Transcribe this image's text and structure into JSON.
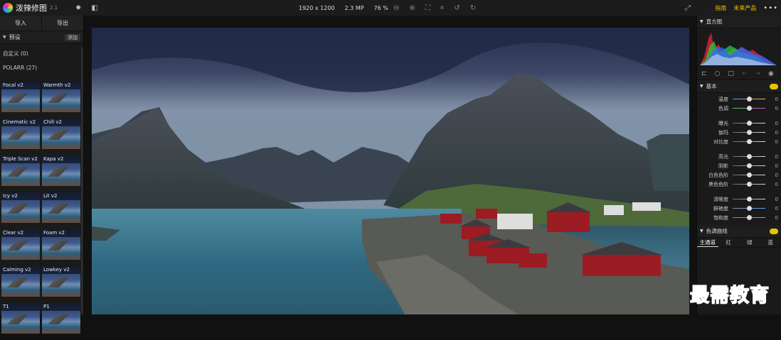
{
  "app": {
    "title": "泼辣修图",
    "version": "2.1"
  },
  "stats": {
    "resolution": "1920 x 1200",
    "megapixels": "2.3 MP",
    "zoom": "76 %"
  },
  "links": {
    "guide": "指南",
    "future": "未来产品"
  },
  "left": {
    "import": "导入",
    "export": "导出",
    "presets_label": "预设",
    "add_label": "添加",
    "custom_group": "自定义 (0)",
    "polarr_group": "POLARR (27)",
    "presets": [
      "Focal v2",
      "Warmth v2",
      "Cinematic v2",
      "Chill v2",
      "Triple Scan v2",
      "Kapa v2",
      "Icy v2",
      "Lit v2",
      "Clear v2",
      "Foam v2",
      "Calming v2",
      "Lowkey v2",
      "T1",
      "P1"
    ]
  },
  "right": {
    "histogram_label": "直方图",
    "basic_label": "基本",
    "sliders": [
      {
        "label": "温度",
        "value": "0",
        "colors": [
          "#4aa3ff",
          "#ffb340"
        ]
      },
      {
        "label": "色调",
        "value": "0",
        "colors": [
          "#3ccb5a",
          "#d34cd6"
        ]
      },
      {
        "label": "曝光",
        "value": "0",
        "colors": [
          "#666",
          "#ddd"
        ]
      },
      {
        "label": "伽玛",
        "value": "0",
        "colors": [
          "#666",
          "#ddd"
        ]
      },
      {
        "label": "对比度",
        "value": "0",
        "colors": [
          "#666",
          "#ddd"
        ]
      },
      {
        "label": "高光",
        "value": "0",
        "colors": [
          "#666",
          "#ddd"
        ]
      },
      {
        "label": "阴影",
        "value": "0",
        "colors": [
          "#666",
          "#ddd"
        ]
      },
      {
        "label": "白色色阶",
        "value": "0",
        "colors": [
          "#666",
          "#ddd"
        ]
      },
      {
        "label": "黑色色阶",
        "value": "0",
        "colors": [
          "#666",
          "#ddd"
        ]
      },
      {
        "label": "清晰度",
        "value": "0",
        "colors": [
          "#666",
          "#ddd"
        ]
      },
      {
        "label": "鲜艳度",
        "value": "0",
        "colors": [
          "#888",
          "#5aa3ff"
        ]
      },
      {
        "label": "饱和度",
        "value": "0",
        "colors": [
          "#888",
          "#5aa3ff"
        ]
      }
    ],
    "curve_label": "色调曲线",
    "curve_tabs": [
      "主通道",
      "红",
      "绿",
      "蓝"
    ]
  },
  "watermark": "最需教育",
  "accent": "#e6c400"
}
